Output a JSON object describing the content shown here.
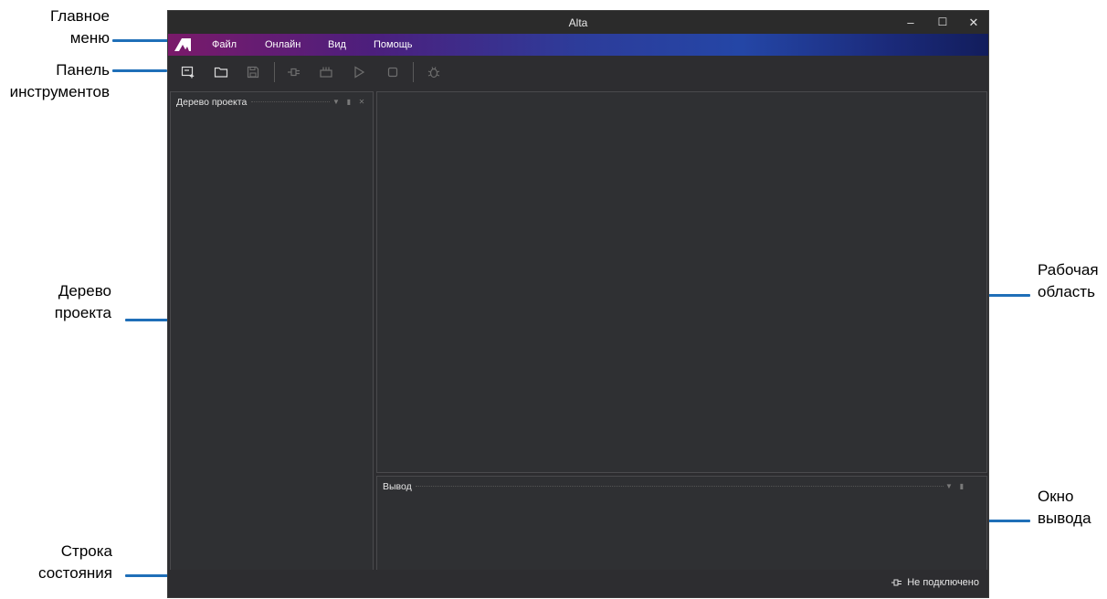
{
  "window": {
    "title": "Alta",
    "minimize_glyph": "–",
    "maximize_glyph": "☐",
    "close_glyph": "✕"
  },
  "menu": {
    "logo_icon": "alta-logo-icon",
    "items": [
      {
        "label": "Файл"
      },
      {
        "label": "Онлайн"
      },
      {
        "label": "Вид"
      },
      {
        "label": "Помощь"
      }
    ]
  },
  "toolbar": {
    "buttons": [
      {
        "icon": "new-project-icon",
        "enabled": true
      },
      {
        "icon": "open-folder-icon",
        "enabled": true
      },
      {
        "icon": "save-icon",
        "enabled": false
      },
      {
        "icon": "connect-icon",
        "enabled": false
      },
      {
        "icon": "device-icon",
        "enabled": false
      },
      {
        "icon": "run-icon",
        "enabled": false
      },
      {
        "icon": "stop-icon",
        "enabled": false
      },
      {
        "icon": "debug-icon",
        "enabled": false
      }
    ]
  },
  "panels": {
    "project_tree": {
      "title": "Дерево проекта"
    },
    "output": {
      "title": "Вывод"
    }
  },
  "statusbar": {
    "connection_icon": "plug-icon",
    "connection_text": "Не подключено"
  },
  "callouts": {
    "main_menu": {
      "line1": "Главное",
      "line2": "меню"
    },
    "toolbar": {
      "line1": "Панель",
      "line2": "инструментов"
    },
    "project_tree": {
      "line1": "Дерево",
      "line2": "проекта"
    },
    "status_bar": {
      "line1": "Строка",
      "line2": "состояния"
    },
    "workspace": {
      "line1": "Рабочая",
      "line2": "область"
    },
    "output_window": {
      "line1": "Окно",
      "line2": "вывода"
    }
  },
  "colors": {
    "accent_line": "#1f6fb8",
    "menu_gradient_start": "#7a1a6a",
    "menu_gradient_end": "#121d5c",
    "window_bg": "#2d2d30"
  }
}
